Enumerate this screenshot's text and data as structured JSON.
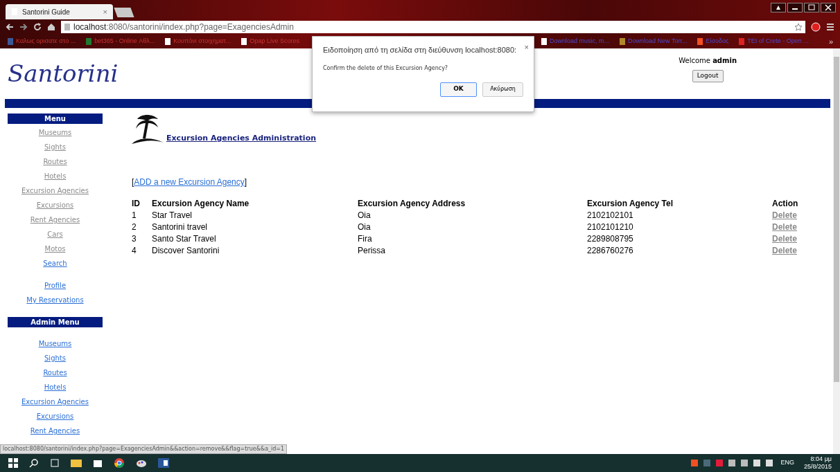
{
  "browser": {
    "tab": {
      "title": "Santorini Guide",
      "close": "×"
    },
    "url_host": "localhost",
    "url_rest": ":8080/santorini/index.php?page=ExagenciesAdmin",
    "bookmarks": [
      {
        "label": "Καλως ορισατε στο ..."
      },
      {
        "label": "bet365 - Online Αθλ..."
      },
      {
        "label": "Κουπόνι στοιχηματ..."
      },
      {
        "label": "Opap Live Scores"
      }
    ],
    "bookmarks_right": [
      {
        "label": "Download music, m..."
      },
      {
        "label": "Download New Torr..."
      },
      {
        "label": "Είσοδος"
      },
      {
        "label": "TEI of Crete - Open ..."
      }
    ],
    "more": "»"
  },
  "header": {
    "logo": "Santorini",
    "welcome": "Welcome",
    "user": "admin",
    "logout": "Logout"
  },
  "menu": {
    "title": "Menu",
    "items": [
      {
        "label": "Museums",
        "visited": true
      },
      {
        "label": "Sights",
        "visited": true
      },
      {
        "label": "Routes",
        "visited": true
      },
      {
        "label": "Hotels",
        "visited": true
      },
      {
        "label": "Excursion Agencies",
        "visited": true
      },
      {
        "label": "Excursions",
        "visited": true
      },
      {
        "label": "Rent Agencies",
        "visited": true
      },
      {
        "label": "Cars",
        "visited": true
      },
      {
        "label": "Motos",
        "visited": true
      },
      {
        "label": "Search",
        "visited": false
      }
    ]
  },
  "user_links": [
    {
      "label": "Profile",
      "visited": false
    },
    {
      "label": "My Reservations",
      "visited": false
    }
  ],
  "admin_menu": {
    "title": "Admin Menu",
    "items": [
      {
        "label": "Museums",
        "visited": false
      },
      {
        "label": "Sights",
        "visited": false
      },
      {
        "label": "Routes",
        "visited": false
      },
      {
        "label": "Hotels",
        "visited": false
      },
      {
        "label": "Excursion Agencies",
        "visited": false
      },
      {
        "label": "Excursions",
        "visited": false
      },
      {
        "label": "Rent Agencies",
        "visited": false
      }
    ]
  },
  "content": {
    "heading": "Excursion Agencies Administration",
    "add_open": "[",
    "add_link": "ADD a new Excursion Agency",
    "add_close": "]",
    "table": {
      "columns": [
        "ID",
        "Excursion Agency Name",
        "Excursion Agency Address",
        "Excursion Agency Tel",
        "Action"
      ],
      "rows": [
        {
          "cells": [
            "1",
            "Star Travel",
            "Oia",
            "2102102101"
          ],
          "action": "Delete"
        },
        {
          "cells": [
            "2",
            "Santorini travel",
            "Oia",
            "2102101210"
          ],
          "action": "Delete"
        },
        {
          "cells": [
            "3",
            "Santo Star Travel",
            "Fira",
            "2289808795"
          ],
          "action": "Delete"
        },
        {
          "cells": [
            "4",
            "Discover Santorini",
            "Perissa",
            "2286760276"
          ],
          "action": "Delete"
        }
      ]
    }
  },
  "dialog": {
    "title": "Ειδοποίηση από τη σελίδα στη διεύθυνση localhost:8080:",
    "close": "×",
    "message": "Confirm the delete of this Excursion Agency?",
    "ok": "OK",
    "cancel": "Ακύρωση"
  },
  "status_url": "localhost:8080/santorini/index.php?page=ExagenciesAdmin&&action=remove&&flag=true&&a_id=1",
  "taskbar": {
    "lang": "ENG",
    "time": "8:04 μμ",
    "date": "25/8/2015"
  }
}
